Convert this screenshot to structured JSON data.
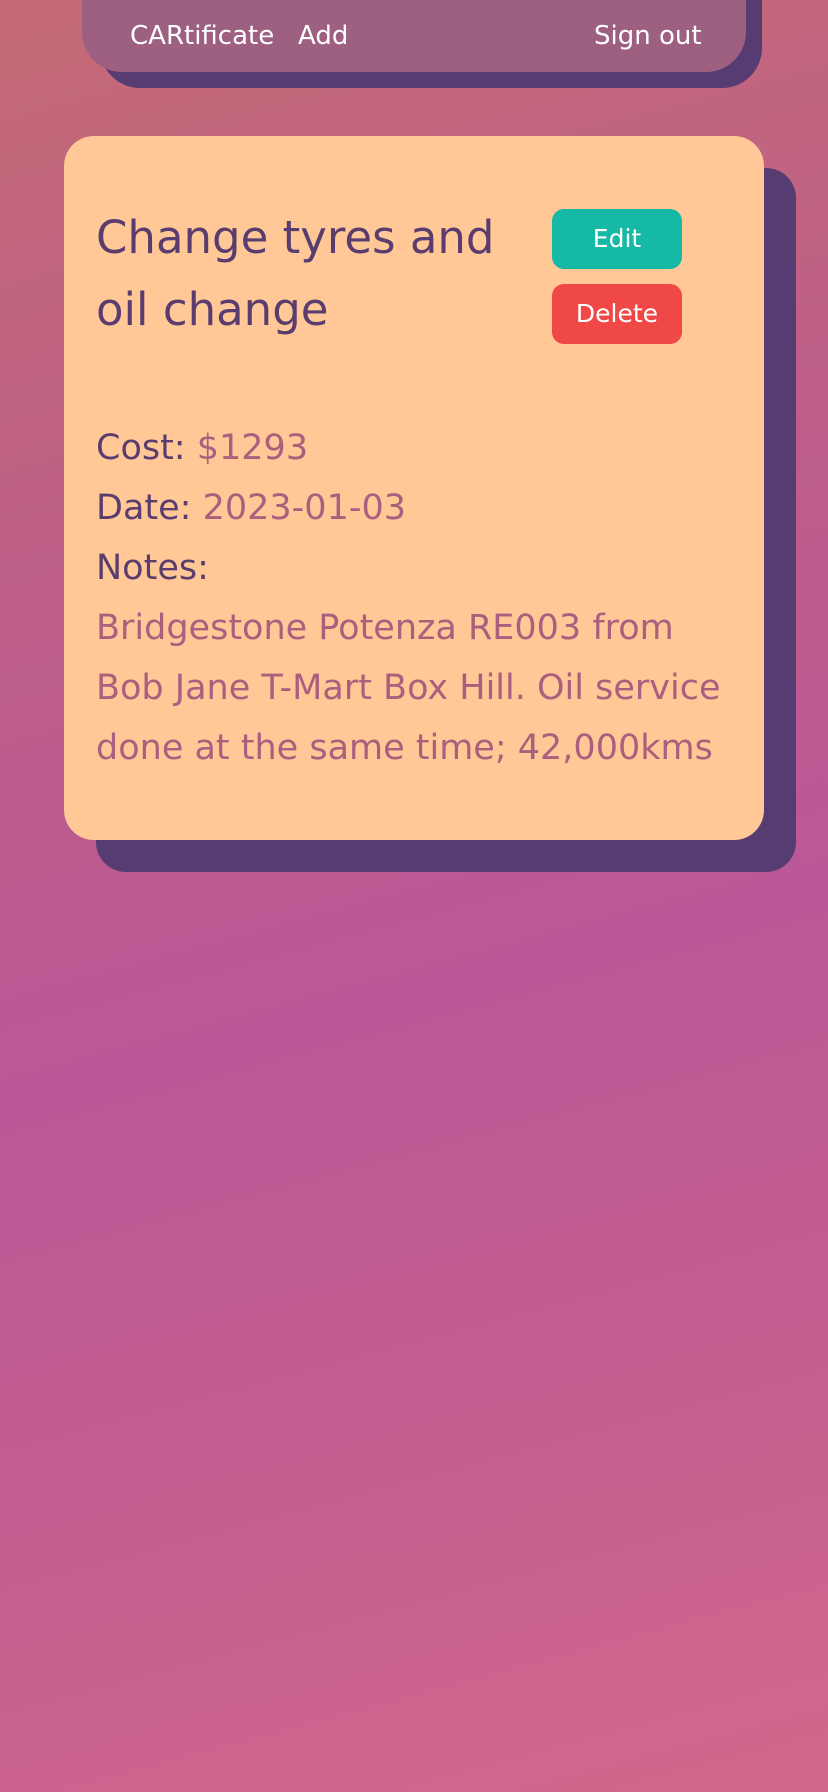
{
  "nav": {
    "brand": "CARtificate",
    "add": "Add",
    "sign_out": "Sign out"
  },
  "record": {
    "title": "Change tyres and oil change",
    "edit_label": "Edit",
    "delete_label": "Delete",
    "cost_label": "Cost:",
    "cost_value": "$1293",
    "date_label": "Date:",
    "date_value": "2023-01-03",
    "notes_label": "Notes:",
    "notes_value": "Bridgestone Potenza RE003 from Bob Jane T-Mart Box Hill. Oil service done at the same time; 42,000kms"
  },
  "colors": {
    "nav_bg": "#9e6080",
    "shadow": "#573c72",
    "card_bg": "#ffc896",
    "edit_button": "#16b8a6",
    "delete_button": "#f04747",
    "label_text": "#5a3d6e",
    "value_text": "#a8607e"
  }
}
